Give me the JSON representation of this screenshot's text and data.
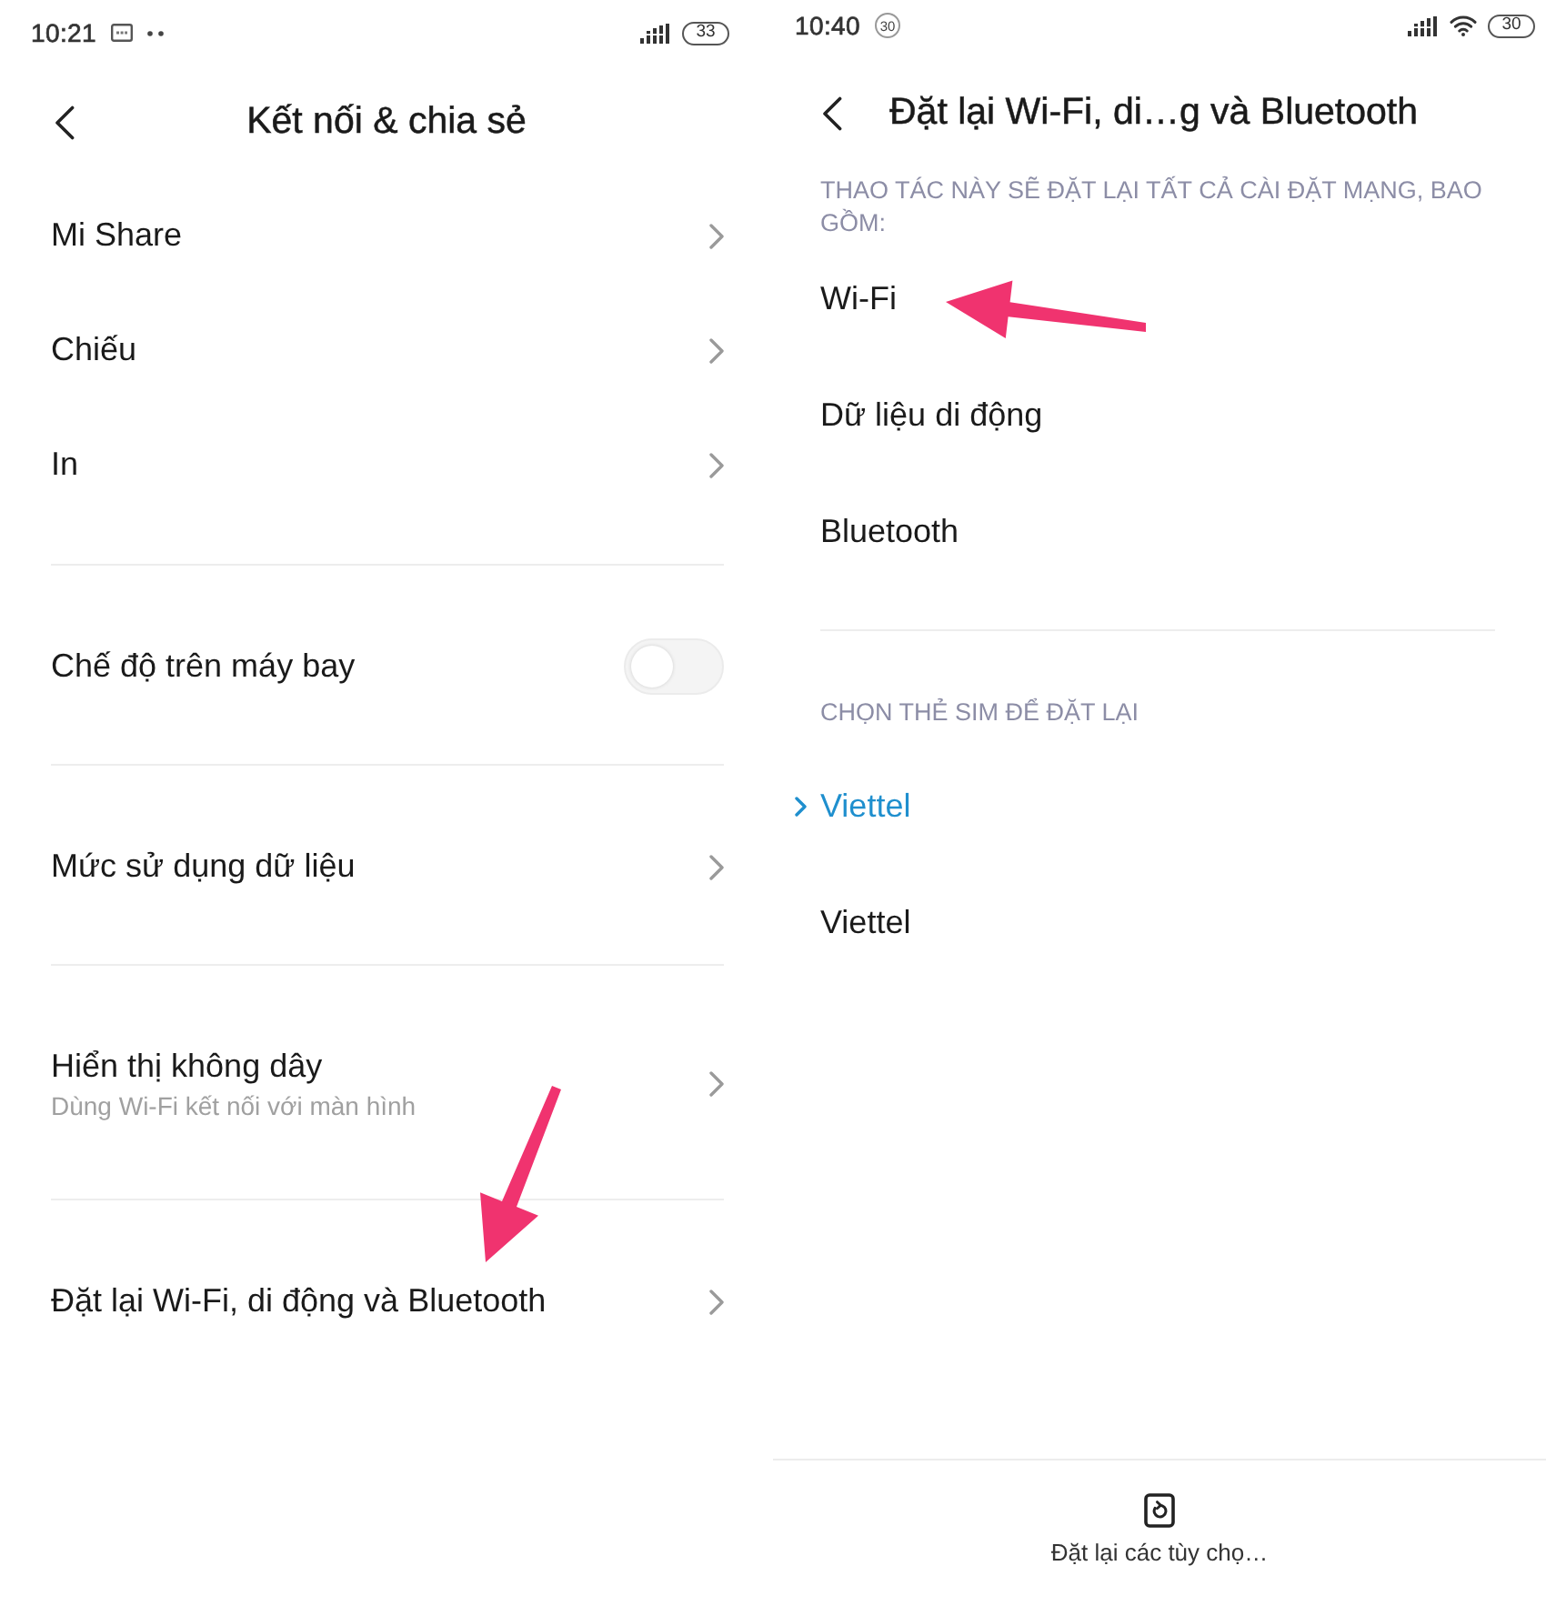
{
  "connection_screen": {
    "status_bar": {
      "time": "10:21",
      "notifications": [
        {
          "kind": "message"
        },
        {
          "kind": "dots"
        }
      ],
      "battery": "33"
    },
    "title": "Kết nối & chia sẻ",
    "groups": [
      {
        "items": [
          {
            "kind": "link",
            "label": "Mi Share",
            "marked_by_arrow": false
          },
          {
            "kind": "link",
            "label": "Chiếu",
            "marked_by_arrow": false
          },
          {
            "kind": "link",
            "label": "In",
            "marked_by_arrow": false
          }
        ]
      },
      {
        "items": [
          {
            "kind": "toggle",
            "label": "Chế độ trên máy bay",
            "on": false,
            "marked_by_arrow": false
          }
        ]
      },
      {
        "items": [
          {
            "kind": "link",
            "label": "Mức sử dụng dữ liệu",
            "marked_by_arrow": false
          }
        ]
      },
      {
        "items": [
          {
            "kind": "link",
            "label": "Hiển thị không dây",
            "subtitle": "Dùng Wi-Fi kết nối với màn hình",
            "marked_by_arrow": false
          }
        ]
      },
      {
        "items": [
          {
            "kind": "link",
            "label": "Đặt lại Wi-Fi, di động và Bluetooth",
            "marked_by_arrow": true
          }
        ]
      }
    ]
  },
  "reset_screen": {
    "status_bar": {
      "time": "10:40",
      "notifications": [
        {
          "kind": "count",
          "text": "30"
        }
      ],
      "wifi": true,
      "battery": "30"
    },
    "title": "Đặt lại Wi-Fi, di…g và Bluetooth",
    "sections": [
      {
        "kind": "info",
        "heading": "THAO TÁC NÀY SẼ ĐẶT LẠI TẤT CẢ CÀI ĐẶT MẠNG, BAO GỒM:",
        "items": [
          {
            "label": "Wi-Fi",
            "marked_by_arrow": true
          },
          {
            "label": "Dữ liệu di động",
            "marked_by_arrow": false
          },
          {
            "label": "Bluetooth",
            "marked_by_arrow": false
          }
        ]
      },
      {
        "kind": "choice",
        "heading": "CHỌN THẺ SIM ĐỂ ĐẶT LẠI",
        "items": [
          {
            "label": "Viettel",
            "selected": true,
            "marked_by_arrow": false
          },
          {
            "label": "Viettel",
            "selected": false,
            "marked_by_arrow": false
          }
        ]
      }
    ],
    "bottom_action": {
      "label": "Đặt lại các tùy chọ…"
    }
  }
}
